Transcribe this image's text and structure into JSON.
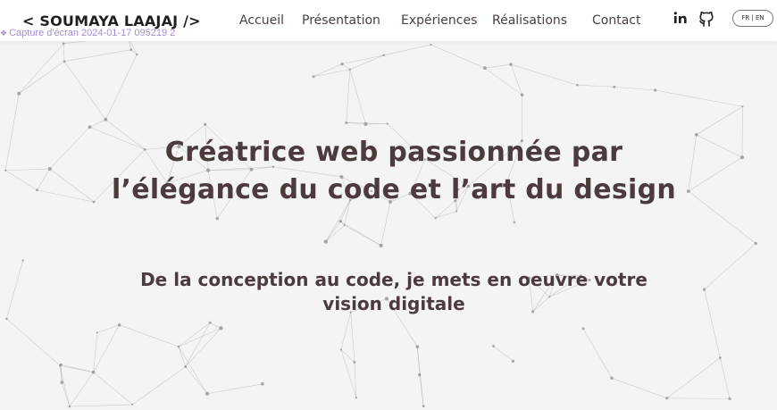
{
  "logo": "< SOUMAYA LAAJAJ />",
  "image_alt": "Capture d'écran 2024-01-17 095219 2",
  "nav": {
    "links": [
      "Accueil",
      "Présentation",
      "Expériences",
      "Réalisations",
      "Contact"
    ],
    "social": [
      "linkedin-icon",
      "github-icon"
    ],
    "lang": "FR | EN"
  },
  "hero": {
    "title_line1": "Créatrice web passionnée par",
    "title_line2": "l’élégance du code et l’art du design",
    "subtitle": "De la conception au code, je mets en oeuvre votre vision digitale"
  },
  "colors": {
    "background": "#f4f4f4",
    "text": "#4b3b3c",
    "alt_text": "#a68ad6"
  }
}
